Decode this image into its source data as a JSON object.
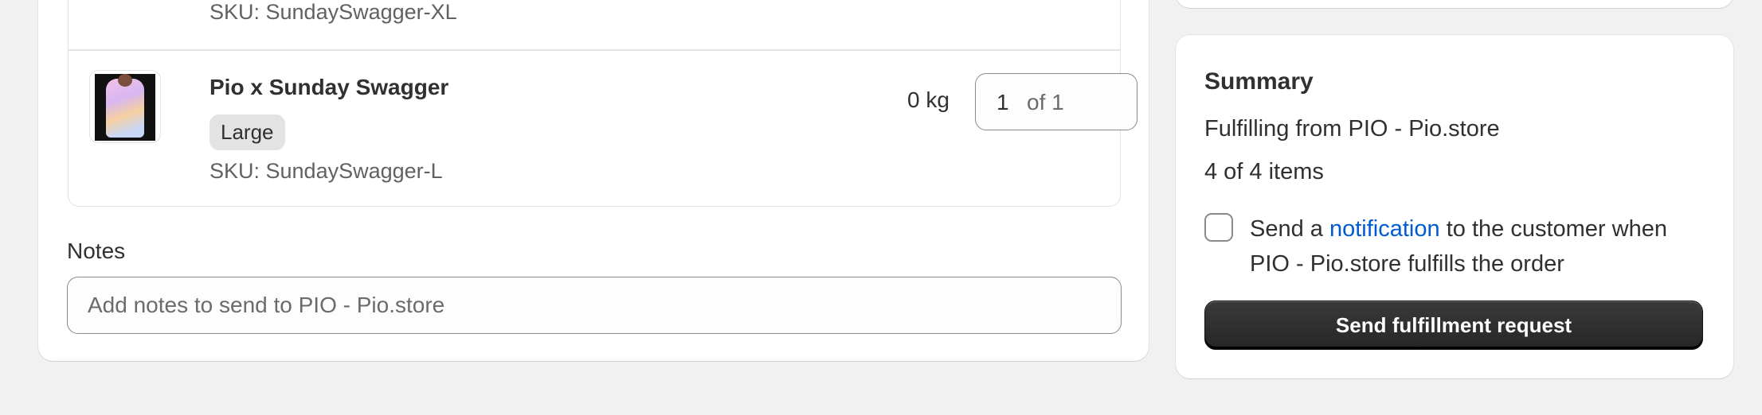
{
  "line_items": {
    "previous_sku": "SKU: SundaySwagger-XL",
    "item": {
      "title": "Pio x Sunday Swagger",
      "variant": "Large",
      "sku": "SKU: SundaySwagger-L",
      "weight": "0 kg",
      "quantity": "1",
      "quantity_of": "of 1",
      "thumbnail_icon": "product-thumbnail"
    }
  },
  "notes": {
    "label": "Notes",
    "placeholder": "Add notes to send to PIO - Pio.store"
  },
  "summary": {
    "title": "Summary",
    "fulfilling_from": "Fulfilling from PIO - Pio.store",
    "items_count": "4 of 4 items",
    "notify_prefix": "Send a",
    "notify_link": "notification",
    "notify_suffix": "to the customer when PIO - Pio.store fulfills the order",
    "button_label": "Send fulfillment request"
  },
  "colors": {
    "background": "#f1f1f1",
    "card": "#ffffff",
    "link": "#005bd3",
    "primary_button": "#303030"
  }
}
